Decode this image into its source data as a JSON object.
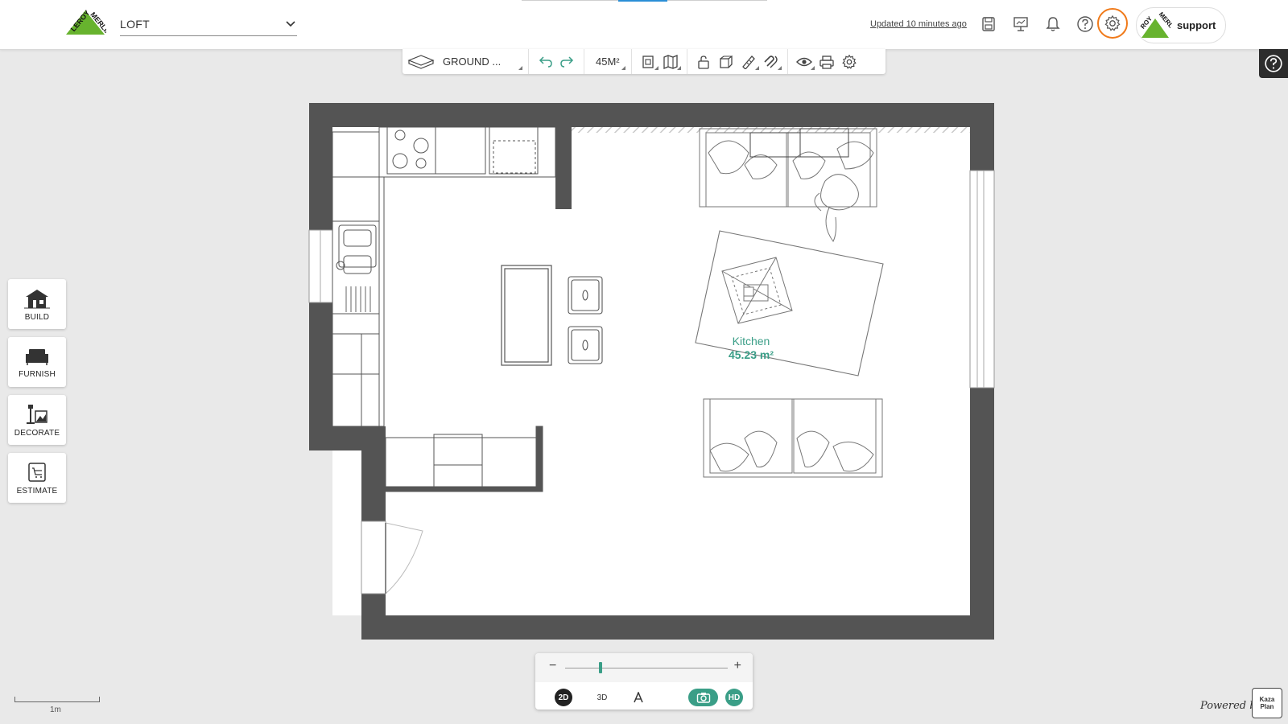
{
  "header": {
    "project_name": "LOFT",
    "updated_text": "Updated 10 minutes ago",
    "support_label": "support"
  },
  "toolbar": {
    "floor_label": "GROUND ...",
    "area_label": "45M²"
  },
  "side_menu": {
    "items": [
      {
        "label": "BUILD"
      },
      {
        "label": "FURNISH"
      },
      {
        "label": "DECORATE"
      },
      {
        "label": "ESTIMATE"
      }
    ]
  },
  "room": {
    "name": "Kitchen",
    "area": "45.23 m²"
  },
  "view_controls": {
    "zoom_value": 0.22,
    "btn_2d": "2D",
    "btn_3d": "3D",
    "btn_hd": "HD",
    "active_view": "2D"
  },
  "scale": {
    "label": "1m"
  },
  "footer": {
    "powered_by": "Powered by",
    "logo_text_1": "Kaza",
    "logo_text_2": "Plan"
  },
  "colors": {
    "accent": "#3a9e87",
    "highlight": "#f07a1a",
    "wall": "#545454",
    "brand_green": "#67b32e"
  }
}
